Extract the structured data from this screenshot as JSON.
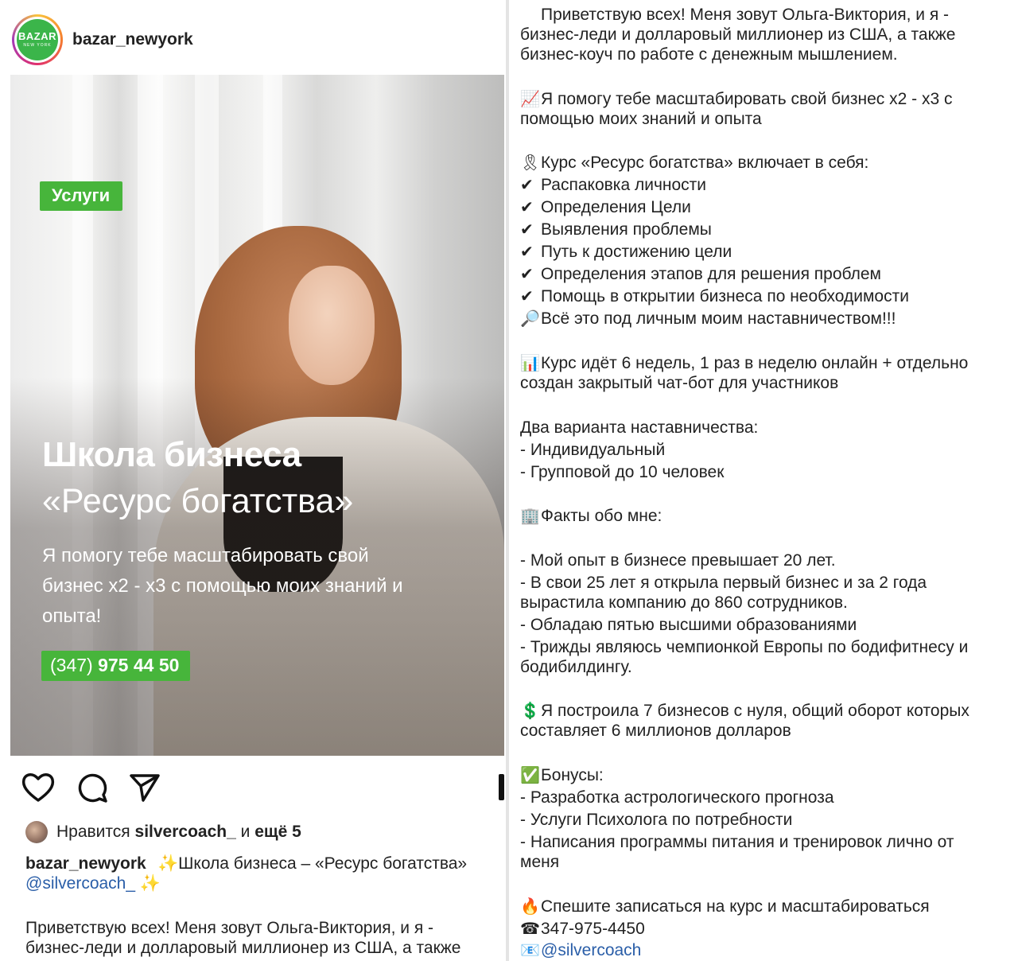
{
  "post": {
    "username": "bazar_newyork",
    "avatar_text": "BAZAR",
    "avatar_subtext": "NEW YORK",
    "image": {
      "badge": "Услуги",
      "headline": "Школа бизнеса",
      "subheadline": "«Ресурс богатства»",
      "lead_line1": "Я помогу тебе масштабировать свой",
      "lead_line2": "бизнес х2 - х3 с помощью моих знаний и",
      "lead_line3": "опыта!",
      "phone_prefix": "(347)",
      "phone_number": "975 44 50"
    },
    "actions": {
      "like_icon": "heart-icon",
      "comment_icon": "comment-icon",
      "share_icon": "send-icon",
      "save_icon": "bookmark-icon"
    },
    "likes": {
      "prefix": "Нравится",
      "user": "silvercoach_",
      "conj": "и",
      "more": "ещё 5"
    },
    "caption": {
      "user": "bazar_newyork",
      "title": "✨Школа бизнеса – «Ресурс богатства»",
      "mention": "@silvercoach_",
      "mention_emoji": "✨",
      "body_line1": "Приветствую всех! Меня зовут Ольга-Виктория, и я -",
      "body_line2": "бизнес-леди и долларовый миллионер из США, а также"
    }
  },
  "description": {
    "lines": [
      {
        "emoji": "",
        "text": "Приветствую всех! Меня зовут Ольга-Виктория, и я -"
      },
      {
        "emoji": "",
        "text": "бизнес-леди и долларовый миллионер из США, а также"
      },
      {
        "emoji": "",
        "text": "бизнес-коуч по работе с денежным мышлением."
      },
      {
        "emoji": "📈",
        "text": "Я помогу тебе масштабировать свой бизнес х2 - х3 с"
      },
      {
        "emoji": "",
        "text": "помощью моих знаний и опыта"
      },
      {
        "emoji": "🎗",
        "text": "Курс «Ресурс богатства» включает в себя:"
      },
      {
        "emoji": "✔",
        "text": "Распаковка личности"
      },
      {
        "emoji": "✔",
        "text": "Определения Цели"
      },
      {
        "emoji": "✔",
        "text": "Выявления проблемы"
      },
      {
        "emoji": "✔",
        "text": "Путь к достижению цели"
      },
      {
        "emoji": "✔",
        "text": "Определения этапов для решения проблем"
      },
      {
        "emoji": "✔",
        "text": "Помощь в открытии бизнеса по необходимости"
      },
      {
        "emoji": "🔎",
        "text": "Всё это под личным моим наставничеством!!!"
      },
      {
        "emoji": "📊",
        "text": "Курс идёт 6 недель, 1 раз в неделю онлайн + отдельно"
      },
      {
        "emoji": "",
        "text": "создан закрытый чат-бот для участников"
      },
      {
        "emoji": "",
        "text": "Два варианта наставничества:"
      },
      {
        "emoji": "",
        "text": "- Индивидуальный"
      },
      {
        "emoji": "",
        "text": "- Групповой до 10 человек"
      },
      {
        "emoji": "🏢",
        "text": "Факты обо мне:"
      },
      {
        "emoji": "",
        "text": "- Мой опыт в бизнесе превышает 20 лет."
      },
      {
        "emoji": "",
        "text": "- В свои 25 лет я открыла первый бизнес и за 2 года"
      },
      {
        "emoji": "",
        "text": "вырастила компанию до 860 сотрудников."
      },
      {
        "emoji": "",
        "text": "- Обладаю пятью высшими образованиями"
      },
      {
        "emoji": "",
        "text": "- Трижды являюсь чемпионкой Европы по бодифитнесу и"
      },
      {
        "emoji": "",
        "text": "бодибилдингу."
      },
      {
        "emoji": "💲",
        "text": "Я построила 7 бизнесов с нуля, общий оборот которых"
      },
      {
        "emoji": "",
        "text": "составляет 6 миллионов долларов"
      },
      {
        "emoji": "✅",
        "text": "Бонусы:"
      },
      {
        "emoji": "",
        "text": "- Разработка астрологического прогноза"
      },
      {
        "emoji": "",
        "text": "- Услуги Психолога по потребности"
      },
      {
        "emoji": "",
        "text": "- Написания программы питания и тренировок лично от"
      },
      {
        "emoji": "",
        "text": "меня"
      },
      {
        "emoji": "🔥",
        "text": "Спешите записаться на курс и масштабироваться"
      },
      {
        "emoji": "☎",
        "text": "347-975-4450"
      },
      {
        "emoji": "📧",
        "text": "@silvercoach"
      }
    ]
  },
  "colors": {
    "accent_green": "#47b53b",
    "link_blue": "#2a5ea8"
  }
}
